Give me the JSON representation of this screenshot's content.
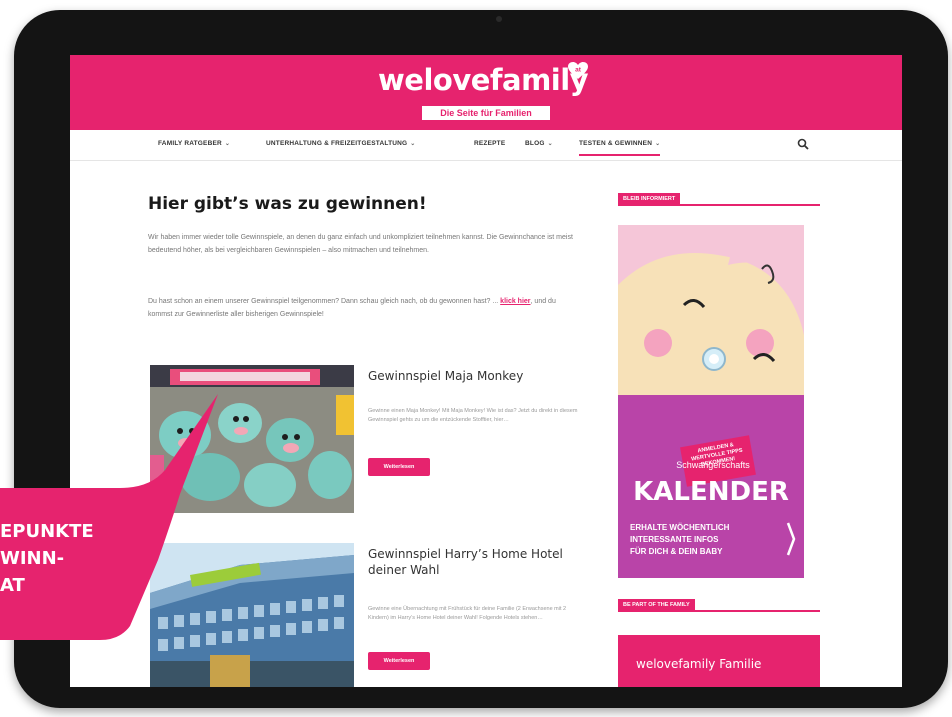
{
  "header": {
    "logo_text": "welovefamily",
    "logo_badge": "at",
    "tagline": "Die Seite für Familien",
    "brand_color": "#e6236e"
  },
  "nav": {
    "items": [
      {
        "label": "FAMILY RATGEBER",
        "has_dropdown": true
      },
      {
        "label": "UNTERHALTUNG & FREIZEITGESTALTUNG",
        "has_dropdown": true
      },
      {
        "label": "REZEPTE",
        "has_dropdown": false
      },
      {
        "label": "BLOG",
        "has_dropdown": true
      },
      {
        "label": "TESTEN & GEWINNEN",
        "has_dropdown": true,
        "active": true
      }
    ],
    "search_icon": "search-icon"
  },
  "main": {
    "title": "Hier gibt’s was zu gewinnen!",
    "intro_1": "Wir haben immer wieder tolle Gewinnspiele, an denen du ganz einfach und unkompliziert teilnehmen kannst. Die Gewinnchance ist meist bedeutend höher, als bei vergleichbaren Gewinnspielen – also mitmachen und teilnehmen.",
    "intro_2_before": "Du hast schon an einem unserer Gewinnspiel teilgenommen? Dann schau gleich nach, ob du gewonnen hast? ...",
    "intro_2_link": "klick hier",
    "intro_2_after": ", und du kommst zur Gewinnerliste aller bisherigen Gewinnspiele!",
    "posts": [
      {
        "title": "Gewinnspiel Maja Monkey",
        "excerpt": "Gewinne einen Maja Monkey! Mit Maja Monkey! Wie ist das? Jetzt du direkt in diesem Gewinnspiel gehts zu um die entzückende Stofftier, hier…",
        "button": "Weiterlesen"
      },
      {
        "title": "Gewinnspiel Harry’s Home Hotel deiner Wahl",
        "excerpt": "Gewinne eine Übernachtung mit Frühstück für deine Familie (2 Erwachsene mit 2 Kindern) im Harry’s Home Hotel deiner Wahl! Folgende Hotels stehen…",
        "button": "Weiterlesen"
      }
    ]
  },
  "sidebar": {
    "label_1": "BLEIB INFORMIERT",
    "ad": {
      "banner": "ANMELDEN & WERTVOLLE TIPPS BEKOMMEN!",
      "small": "Schwangerschafts",
      "big": "KALENDER",
      "line_1": "ERHALTE WÖCHENTLICH",
      "line_2": "INTERESSANTE INFOS",
      "line_3": "FÜR DICH & DEIN BABY"
    },
    "label_2": "BE PART OF THE FAMILY",
    "family_box": "welovefamily Familie"
  },
  "callout": {
    "line_1": "EPUNKTE",
    "line_2": "WINN-",
    "line_3": "AT",
    "color": "#e6236e"
  }
}
